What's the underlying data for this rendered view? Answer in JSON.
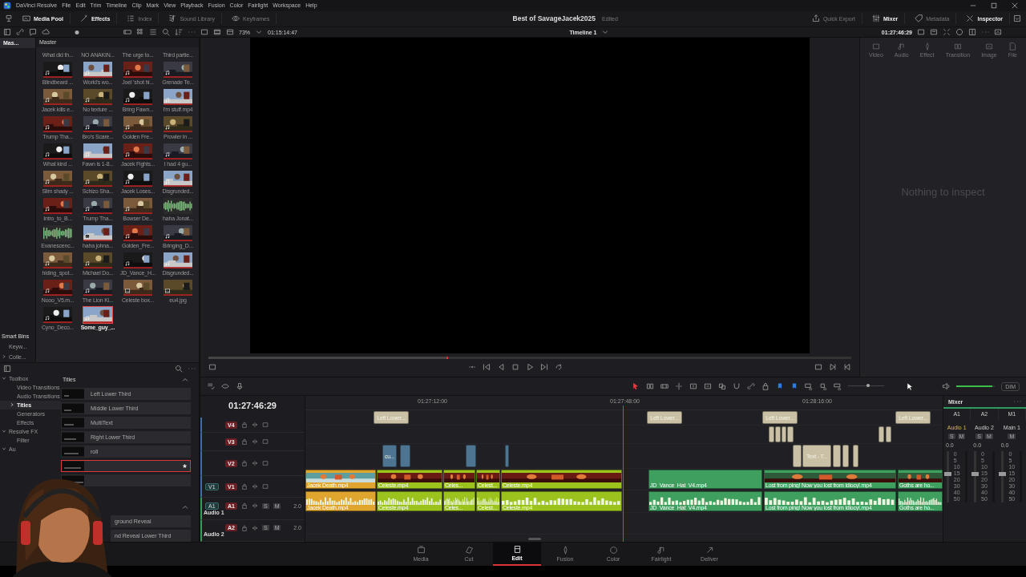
{
  "menu_bar": {
    "app": "DaVinci Resolve",
    "items": [
      "File",
      "Edit",
      "Trim",
      "Timeline",
      "Clip",
      "Mark",
      "View",
      "Playback",
      "Fusion",
      "Color",
      "Fairlight",
      "Workspace",
      "Help"
    ]
  },
  "toolbar": {
    "left": [
      {
        "label": "Media Pool",
        "on": true
      },
      {
        "label": "Effects",
        "on": true
      },
      {
        "label": "Index",
        "on": false
      },
      {
        "label": "Sound Library",
        "on": false
      },
      {
        "label": "Keyframes",
        "on": false
      }
    ],
    "project_title": "Best of SavageJacek2025",
    "project_status": "Edited",
    "right": [
      {
        "label": "Quick Export",
        "on": false
      },
      {
        "label": "Mixer",
        "on": true
      },
      {
        "label": "Metadata",
        "on": false
      },
      {
        "label": "Inspector",
        "on": true
      }
    ]
  },
  "viewer_bar": {
    "zoom": "73%",
    "source_timecode": "01:15:14:47",
    "timeline": "Timeline 1",
    "timecode": "01:27:46:29"
  },
  "bins": {
    "items": [
      {
        "label": "Mas...",
        "selected": true
      }
    ],
    "smart_bins": "Smart Bins",
    "smart_items": [
      {
        "label": "Keyw...",
        "kind": "leaf"
      },
      {
        "label": "Colle...",
        "expanded": false,
        "kind": "group"
      }
    ]
  },
  "media_pool": {
    "header": "Master",
    "thumbnail_size": {
      "level": 0.2
    },
    "clips": [
      {
        "label": "What did th...",
        "kind": "cut",
        "selected": false
      },
      {
        "label": "NO ANAKIN...",
        "kind": "cut",
        "selected": false
      },
      {
        "label": "The urge to...",
        "kind": "cut",
        "selected": false
      },
      {
        "label": "Third partie...",
        "kind": "cut",
        "selected": false
      },
      {
        "label": "Blindbeard ...",
        "kind": "video",
        "selected": false
      },
      {
        "label": "World's wo...",
        "kind": "video",
        "selected": false
      },
      {
        "label": "Joel 'shot hi...",
        "kind": "video",
        "selected": false
      },
      {
        "label": "Grenade Te...",
        "kind": "video",
        "selected": false
      },
      {
        "label": "Jacek kills e...",
        "kind": "video",
        "selected": false
      },
      {
        "label": "No texture ...",
        "kind": "video",
        "selected": false
      },
      {
        "label": "Bring Fawn...",
        "kind": "video",
        "selected": false
      },
      {
        "label": "I'm stuff.mp4",
        "kind": "video",
        "selected": false
      },
      {
        "label": "Trump Tha...",
        "kind": "video",
        "selected": false
      },
      {
        "label": "Bro's Scare...",
        "kind": "video",
        "selected": false
      },
      {
        "label": "Golden Fre...",
        "kind": "video",
        "selected": false
      },
      {
        "label": "Prowler in ...",
        "kind": "video",
        "selected": false
      },
      {
        "label": "What kind ...",
        "kind": "video",
        "selected": false
      },
      {
        "label": "Fawn is 1-8...",
        "kind": "video",
        "selected": false
      },
      {
        "label": "Jacek Fights...",
        "kind": "video",
        "selected": false
      },
      {
        "label": "I had 4 gu...",
        "kind": "video",
        "selected": false
      },
      {
        "label": "Slim shady ...",
        "kind": "video",
        "selected": false
      },
      {
        "label": "Schizo Sha...",
        "kind": "video",
        "selected": false
      },
      {
        "label": "Jacek Loses...",
        "kind": "video",
        "selected": false
      },
      {
        "label": "Disgrunded...",
        "kind": "video",
        "selected": false
      },
      {
        "label": "Intro_to_B...",
        "kind": "video",
        "selected": false
      },
      {
        "label": "Trump Tha...",
        "kind": "video",
        "selected": false
      },
      {
        "label": "Bowser De...",
        "kind": "video",
        "selected": false
      },
      {
        "label": "haha Jonat...",
        "kind": "audio",
        "selected": false
      },
      {
        "label": "Evanescenc...",
        "kind": "audio",
        "selected": false
      },
      {
        "label": "haha johna...",
        "kind": "still",
        "selected": false
      },
      {
        "label": "Golden_Fre...",
        "kind": "video",
        "selected": false
      },
      {
        "label": "Bringing_D...",
        "kind": "video",
        "selected": false
      },
      {
        "label": "hiding_spot...",
        "kind": "video",
        "selected": false
      },
      {
        "label": "Michael Do...",
        "kind": "video",
        "selected": false
      },
      {
        "label": "JD_Vance_H...",
        "kind": "video",
        "selected": false
      },
      {
        "label": "Disgrunded...",
        "kind": "video",
        "selected": false
      },
      {
        "label": "Nooo_V5.m...",
        "kind": "video",
        "selected": false
      },
      {
        "label": "The Lion Ki...",
        "kind": "video",
        "selected": false
      },
      {
        "label": "Celeste box...",
        "kind": "still",
        "selected": false
      },
      {
        "label": "eu4.jpg",
        "kind": "still",
        "selected": false
      },
      {
        "label": "Cyno_Deco...",
        "kind": "video",
        "selected": false
      },
      {
        "label": "Some_guy_...",
        "kind": "video",
        "selected": true
      }
    ]
  },
  "viewer": {
    "scrubber": {
      "level": 0.37
    }
  },
  "inspector": {
    "tabs": [
      {
        "label": "Video",
        "disabled": true
      },
      {
        "label": "Audio",
        "disabled": true
      },
      {
        "label": "Effect",
        "disabled": true
      },
      {
        "label": "Transition",
        "disabled": true
      },
      {
        "label": "Image",
        "disabled": true
      },
      {
        "label": "File",
        "disabled": true
      }
    ],
    "empty_message": "Nothing to inspect"
  },
  "effects": {
    "tree": [
      {
        "label": "Toolbox",
        "expanded": true,
        "selected": false,
        "children": [
          {
            "label": "Video Transitions",
            "selected": false
          },
          {
            "label": "Audio Transitions",
            "selected": false
          },
          {
            "label": "Titles",
            "selected": true
          },
          {
            "label": "Generators",
            "selected": false
          },
          {
            "label": "Effects",
            "selected": false
          }
        ]
      },
      {
        "label": "Resolve FX",
        "expanded": true,
        "selected": false,
        "children": [
          {
            "label": "Filter",
            "selected": false
          }
        ]
      },
      {
        "label": "Au",
        "expanded": true,
        "selected": false
      }
    ],
    "section_title": "Titles",
    "items": [
      {
        "label": "Left Lower Third",
        "kind": "full",
        "selected": false
      },
      {
        "label": "Middle Lower Third",
        "kind": "full",
        "selected": false
      },
      {
        "label": "MultiText",
        "kind": "full",
        "selected": false
      },
      {
        "label": "Right Lower Third",
        "kind": "full",
        "selected": false
      },
      {
        "label": "roll",
        "kind": "full",
        "selected": false
      },
      {
        "kind": "full",
        "selected": true
      },
      {
        "kind": "full",
        "selected": false
      }
    ],
    "items_2": [
      {
        "label": "ground Reveal",
        "kind": "cut",
        "selected": false
      },
      {
        "label": "nd Reveal Lower Third",
        "kind": "cut",
        "selected": false
      }
    ]
  },
  "timeline": {
    "timecode": "01:27:46:29",
    "ruler": [
      "01:27:12:00",
      "01:27:48:00",
      "01:28:16:00"
    ],
    "zoom": {
      "level": 0.55
    },
    "tracks": [
      {
        "name": "V4",
        "kind": "video",
        "clips": [
          {
            "label": "Left Lower...",
            "color": "#c9c0a6"
          },
          {
            "label": "Left Lower...",
            "color": "#c9c0a6"
          },
          {
            "label": "Left Lower...",
            "color": "#c9c0a6"
          },
          {
            "label": "Left Lower...",
            "color": "#c9c0a6"
          }
        ]
      },
      {
        "name": "V3",
        "kind": "video",
        "clips": [
          {
            "color": "#c9c0a6"
          },
          {
            "color": "#c9c0a6"
          },
          {
            "color": "#c9c0a6"
          },
          {
            "color": "#c9c0a6"
          },
          {
            "color": "#c9c0a6"
          },
          {
            "color": "#c9c0a6"
          }
        ]
      },
      {
        "name": "V2",
        "kind": "video",
        "clips": [
          {
            "label": "cu...",
            "color": "#4d7591"
          },
          {
            "color": "#4d7591"
          },
          {
            "color": "#4d7591"
          },
          {
            "color": "#4d7591"
          },
          {
            "color": "#c9c0a6"
          },
          {
            "label": "Text - T...",
            "color": "#c9c0a6"
          },
          {
            "color": "#c9c0a6"
          },
          {
            "color": "#c9c0a6"
          },
          {
            "color": "#c9c0a6"
          }
        ]
      },
      {
        "name": "V1",
        "kind": "video",
        "source": "V1",
        "clips": [
          {
            "label": "Jacek Death.mp4",
            "color": "#e0a52e"
          },
          {
            "label": "Celeste.mp4",
            "color": "#9cc31d"
          },
          {
            "label": "Celes...",
            "color": "#9cc31d"
          },
          {
            "label": "Celest...",
            "color": "#9cc31d"
          },
          {
            "label": "Celeste.mp4",
            "color": "#9cc31d"
          },
          {
            "label": "JD_Vance_Hat_V4.mp4",
            "color": "#3f9f5f"
          },
          {
            "label": "Lost from ping! Now you lost from idiocy!.mp4",
            "color": "#3f9f5f"
          },
          {
            "label": "Goths are ho...",
            "color": "#3f9f5f"
          }
        ]
      },
      {
        "name": "A1",
        "kind": "audio",
        "source": "A1",
        "title": "Audio 1",
        "channels": "2.0",
        "solo": "S",
        "mute": "M",
        "clips": [
          {
            "label": "Jacek Death.mp4",
            "color": "#e0a52e"
          },
          {
            "label": "Celeste.mp4",
            "color": "#9cc31d"
          },
          {
            "label": "Celes...",
            "color": "#9cc31d"
          },
          {
            "label": "Celest...",
            "color": "#9cc31d"
          },
          {
            "label": "Celeste.mp4",
            "color": "#9cc31d"
          },
          {
            "label": "JD_Vance_Hat_V4.mp4",
            "color": "#3f9f5f"
          },
          {
            "label": "Lost from ping! Now you lost from idiocy!.mp4",
            "color": "#3f9f5f"
          },
          {
            "label": "Goths are ho...",
            "color": "#3f9f5f"
          }
        ]
      },
      {
        "name": "A2",
        "kind": "audio",
        "title": "Audio 2",
        "channels": "2.0",
        "solo": "S",
        "mute": "M"
      }
    ]
  },
  "monitor": {
    "volume": {
      "level": 0.93
    },
    "dim": "DIM"
  },
  "mixer": {
    "title": "Mixer",
    "strips": [
      {
        "id": "A1",
        "name": "Audio 1",
        "selected": true,
        "solo": "S",
        "mute": "M",
        "gain": "0.0",
        "level": 0.55,
        "scale": [
          "0",
          "5",
          "10",
          "15",
          "20",
          "30",
          "40",
          "50"
        ]
      },
      {
        "id": "A2",
        "name": "Audio 2",
        "selected": false,
        "solo": "S",
        "mute": "M",
        "gain": "0.0",
        "level": 0.55,
        "scale": [
          "0",
          "5",
          "10",
          "15",
          "20",
          "30",
          "40",
          "50"
        ]
      },
      {
        "id": "M1",
        "name": "Main 1",
        "selected": false,
        "mute": "M",
        "gain": "0.0",
        "level": 0.55,
        "scale": [
          "0",
          "5",
          "10",
          "15",
          "20",
          "30",
          "40",
          "50"
        ]
      }
    ]
  },
  "pages": [
    {
      "label": "Media",
      "selected": false
    },
    {
      "label": "Cut",
      "selected": false
    },
    {
      "label": "Edit",
      "selected": true
    },
    {
      "label": "Fusion",
      "selected": false
    },
    {
      "label": "Color",
      "selected": false
    },
    {
      "label": "Fairlight",
      "selected": false
    },
    {
      "label": "Deliver",
      "selected": false
    }
  ]
}
